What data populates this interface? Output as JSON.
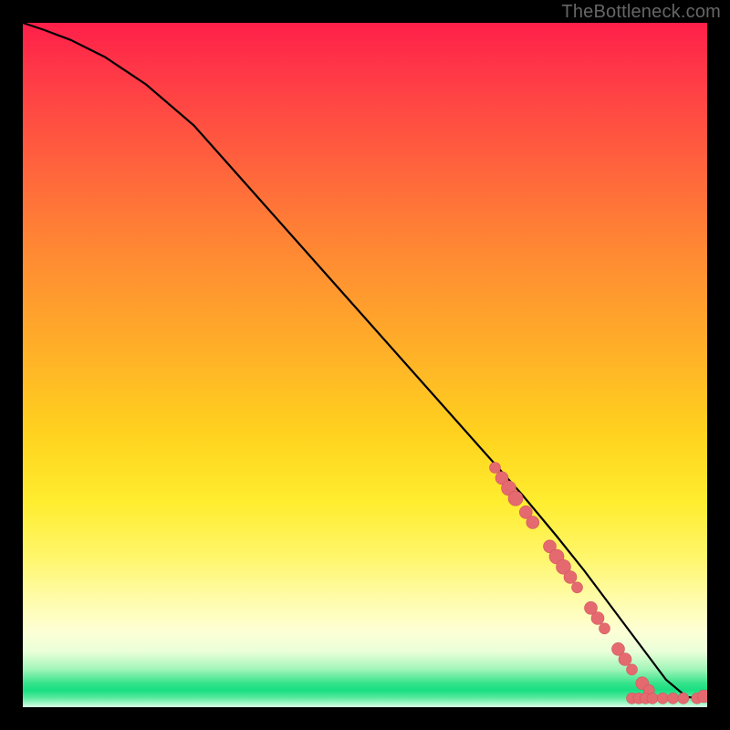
{
  "watermark": "TheBottleneck.com",
  "chart_data": {
    "type": "line",
    "title": "",
    "xlabel": "",
    "ylabel": "",
    "xlim": [
      0,
      100
    ],
    "ylim": [
      0,
      100
    ],
    "series": [
      {
        "name": "curve",
        "x": [
          0,
          3,
          7,
          12,
          18,
          25,
          33,
          41,
          49,
          57,
          65,
          73,
          78,
          82,
          85,
          88,
          91,
          94,
          97,
          100
        ],
        "y": [
          100,
          99,
          97.5,
          95,
          91,
          85,
          76,
          67,
          58,
          49,
          40,
          31,
          25,
          20,
          16,
          12,
          8,
          4,
          1.5,
          1.2
        ]
      }
    ],
    "scatter": {
      "name": "dots",
      "points": [
        {
          "x": 69,
          "y": 35,
          "r": 6
        },
        {
          "x": 70,
          "y": 33.5,
          "r": 7
        },
        {
          "x": 71,
          "y": 32,
          "r": 8
        },
        {
          "x": 72,
          "y": 30.5,
          "r": 8
        },
        {
          "x": 73.5,
          "y": 28.5,
          "r": 7
        },
        {
          "x": 74.5,
          "y": 27,
          "r": 7
        },
        {
          "x": 77,
          "y": 23.5,
          "r": 7
        },
        {
          "x": 78,
          "y": 22,
          "r": 8
        },
        {
          "x": 79,
          "y": 20.5,
          "r": 8
        },
        {
          "x": 80,
          "y": 19,
          "r": 7
        },
        {
          "x": 81,
          "y": 17.5,
          "r": 6
        },
        {
          "x": 83,
          "y": 14.5,
          "r": 7
        },
        {
          "x": 84,
          "y": 13,
          "r": 7
        },
        {
          "x": 85,
          "y": 11.5,
          "r": 6
        },
        {
          "x": 87,
          "y": 8.5,
          "r": 7
        },
        {
          "x": 88,
          "y": 7,
          "r": 7
        },
        {
          "x": 89,
          "y": 5.5,
          "r": 6
        },
        {
          "x": 90.5,
          "y": 3.5,
          "r": 7
        },
        {
          "x": 91.5,
          "y": 2.5,
          "r": 6
        },
        {
          "x": 89,
          "y": 1.3,
          "r": 6
        },
        {
          "x": 90,
          "y": 1.3,
          "r": 6
        },
        {
          "x": 91,
          "y": 1.3,
          "r": 6
        },
        {
          "x": 92,
          "y": 1.3,
          "r": 6
        },
        {
          "x": 93.5,
          "y": 1.3,
          "r": 6
        },
        {
          "x": 95,
          "y": 1.3,
          "r": 6
        },
        {
          "x": 96.5,
          "y": 1.3,
          "r": 6
        },
        {
          "x": 98.5,
          "y": 1.3,
          "r": 6
        },
        {
          "x": 99.5,
          "y": 1.6,
          "r": 7
        }
      ]
    },
    "gradient_stops": [
      {
        "pos": 0,
        "color": "#ff1f49"
      },
      {
        "pos": 50,
        "color": "#ffb028"
      },
      {
        "pos": 80,
        "color": "#fff66a"
      },
      {
        "pos": 96,
        "color": "#36e38b"
      },
      {
        "pos": 100,
        "color": "#d7ffe6"
      }
    ]
  }
}
